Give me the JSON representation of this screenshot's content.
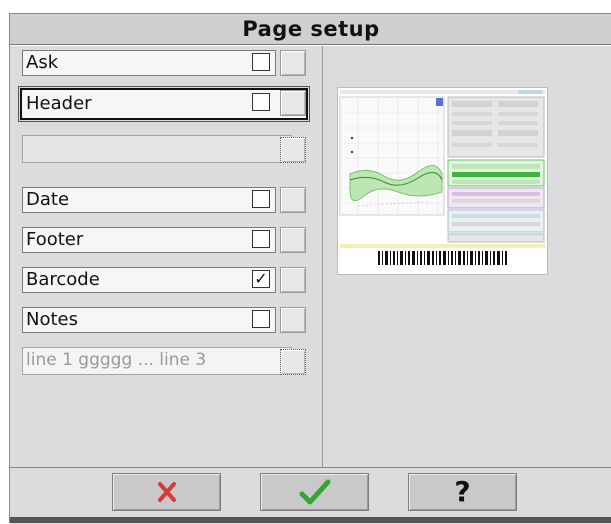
{
  "dialog": {
    "title": "Page setup",
    "rows": [
      {
        "label": "Ask",
        "checked": false
      },
      {
        "label": "Header",
        "checked": false
      },
      {
        "label": ""
      },
      {
        "label": "Date",
        "checked": false
      },
      {
        "label": "Footer",
        "checked": false
      },
      {
        "label": "Barcode",
        "checked": true,
        "check_glyph": "✓"
      },
      {
        "label": "Notes",
        "checked": false
      },
      {
        "label": "line 1 ggggg  ...  line 3"
      }
    ]
  },
  "icons": {
    "cancel": "cross-icon",
    "confirm": "checkmark-icon",
    "help": "question-icon"
  },
  "buttons": {
    "help_label": "?"
  },
  "colors": {
    "cancel_red": "#d63a3a",
    "confirm_green": "#2ea82e"
  }
}
